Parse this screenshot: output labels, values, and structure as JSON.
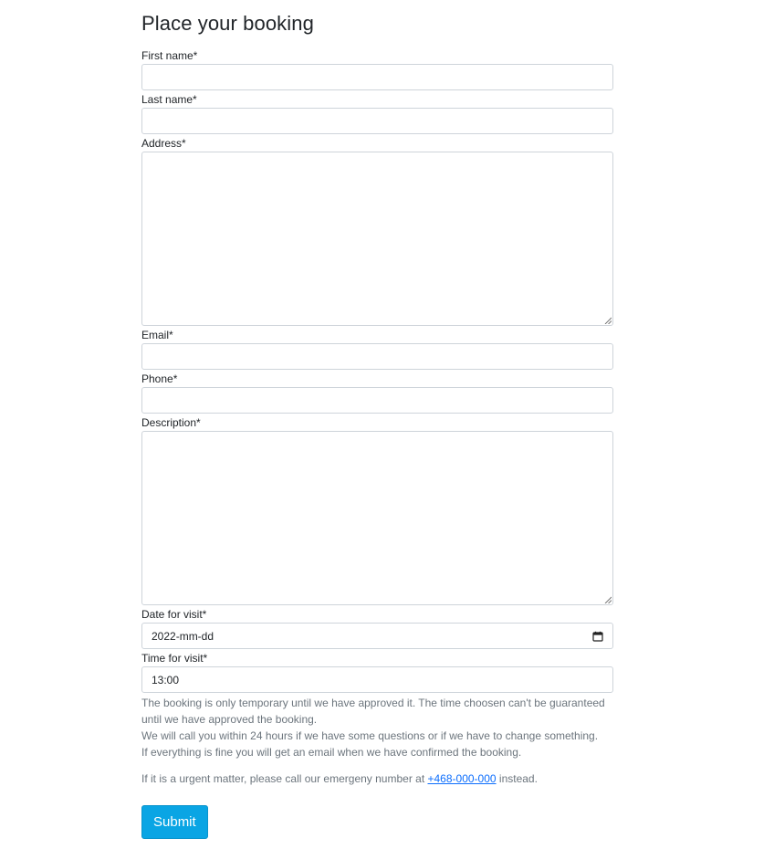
{
  "form": {
    "title": "Place your booking",
    "fields": {
      "first_name": {
        "label": "First name*",
        "value": ""
      },
      "last_name": {
        "label": "Last name*",
        "value": ""
      },
      "address": {
        "label": "Address*",
        "value": ""
      },
      "email": {
        "label": "Email*",
        "value": ""
      },
      "phone": {
        "label": "Phone*",
        "value": ""
      },
      "description": {
        "label": "Description*",
        "value": ""
      },
      "date": {
        "label": "Date for visit*",
        "value": "2022-mm-dd"
      },
      "time": {
        "label": "Time for visit*",
        "value": "13:00"
      }
    },
    "help": {
      "line1": "The booking is only temporary until we have approved it. The time choosen can't be guaranteed until we have approved the booking.",
      "line2": "We will call you within 24 hours if we have some questions or if we have to change something.",
      "line3": "If everything is fine you will get an email when we have confirmed the booking.",
      "urgent_prefix": "If it is a urgent matter, please call our emergeny number at ",
      "urgent_phone": "+468-000-000",
      "urgent_suffix": " instead."
    },
    "submit_label": "Submit",
    "icons": {
      "date": "calendar-icon",
      "textarea_grip": "resize-grip-icon"
    },
    "colors": {
      "submit_bg": "#0aa5e4",
      "link": "#0d6efd",
      "muted_text": "#6c757d",
      "border": "#ced4da"
    }
  }
}
